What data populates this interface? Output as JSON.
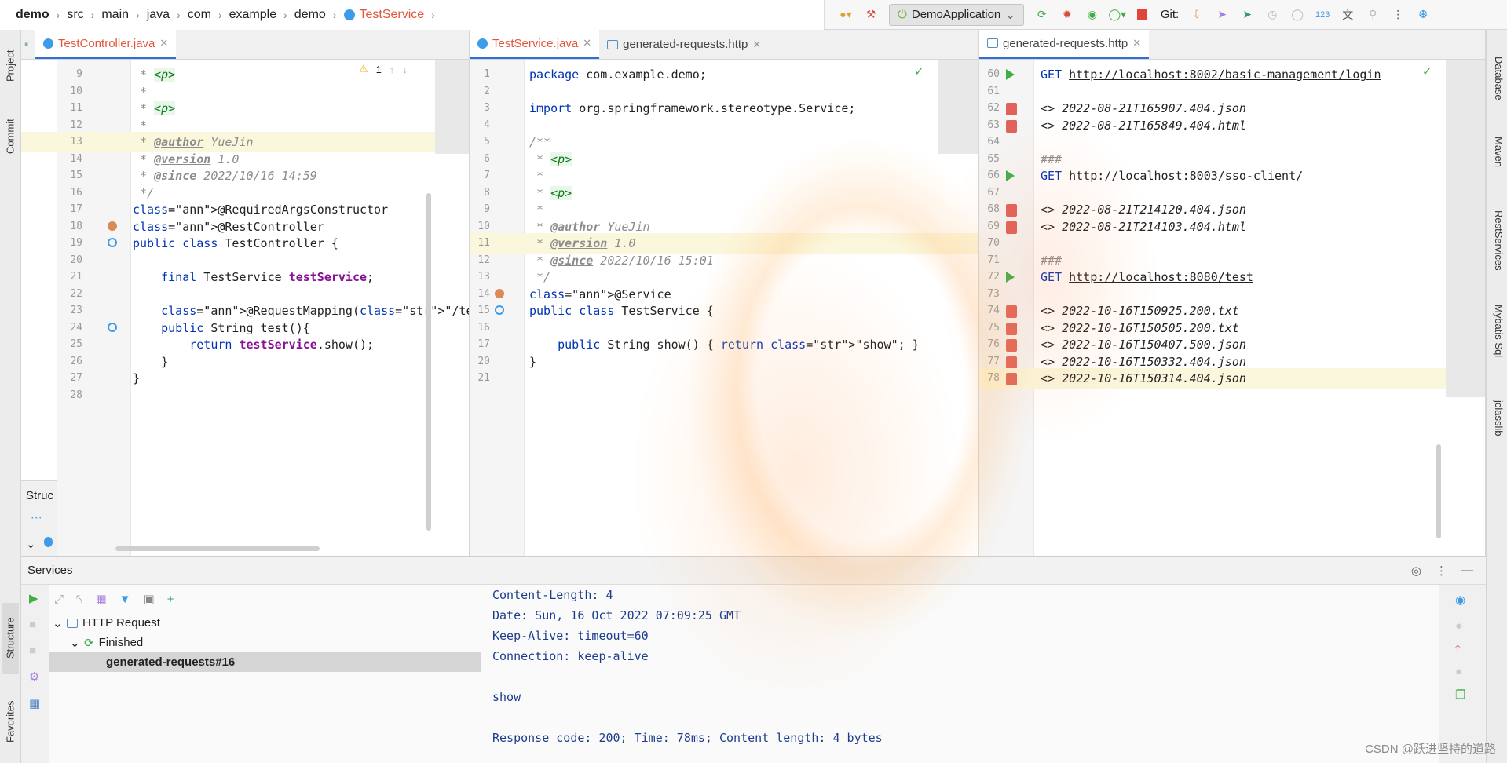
{
  "breadcrumb": [
    "demo",
    "src",
    "main",
    "java",
    "com",
    "example",
    "demo",
    "TestService"
  ],
  "run_config": "DemoApplication",
  "git_label": "Git:",
  "left_strip": {
    "project": "Project",
    "commit": "Commit",
    "structure": "Structure",
    "favorites": "Favorites"
  },
  "right_strip": [
    "Database",
    "Maven",
    "RestServices",
    "Mybatis Sql",
    "jclasslib"
  ],
  "pane1": {
    "tab": "TestController.java",
    "warning_count": "1",
    "lines": [
      {
        "n": "9",
        "t": " * <p>"
      },
      {
        "n": "10",
        "t": " *"
      },
      {
        "n": "11",
        "t": " * <p>"
      },
      {
        "n": "12",
        "t": " *"
      },
      {
        "n": "13",
        "t": " * @author YueJin"
      },
      {
        "n": "14",
        "t": " * @version 1.0"
      },
      {
        "n": "15",
        "t": " * @since 2022/10/16 14:59"
      },
      {
        "n": "16",
        "t": " */"
      },
      {
        "n": "17",
        "t": "@RequiredArgsConstructor"
      },
      {
        "n": "18",
        "t": "@RestController"
      },
      {
        "n": "19",
        "t": "public class TestController {"
      },
      {
        "n": "20",
        "t": ""
      },
      {
        "n": "21",
        "t": "    final TestService testService;"
      },
      {
        "n": "22",
        "t": ""
      },
      {
        "n": "23",
        "t": "    @RequestMapping(\"/test\")"
      },
      {
        "n": "24",
        "t": "    public String test(){"
      },
      {
        "n": "25",
        "t": "        return testService.show();"
      },
      {
        "n": "26",
        "t": "    }"
      },
      {
        "n": "27",
        "t": "}"
      },
      {
        "n": "28",
        "t": ""
      }
    ]
  },
  "pane2": {
    "tabs": [
      "TestService.java",
      "generated-requests.http"
    ],
    "lines": [
      {
        "n": "1",
        "t": "package com.example.demo;"
      },
      {
        "n": "2",
        "t": ""
      },
      {
        "n": "3",
        "t": "import org.springframework.stereotype.Service;"
      },
      {
        "n": "4",
        "t": ""
      },
      {
        "n": "5",
        "t": "/**"
      },
      {
        "n": "6",
        "t": " * <p>"
      },
      {
        "n": "7",
        "t": " *"
      },
      {
        "n": "8",
        "t": " * <p>"
      },
      {
        "n": "9",
        "t": " *"
      },
      {
        "n": "10",
        "t": " * @author YueJin"
      },
      {
        "n": "11",
        "t": " * @version 1.0"
      },
      {
        "n": "12",
        "t": " * @since 2022/10/16 15:01"
      },
      {
        "n": "13",
        "t": " */"
      },
      {
        "n": "14",
        "t": "@Service"
      },
      {
        "n": "15",
        "t": "public class TestService {"
      },
      {
        "n": "16",
        "t": ""
      },
      {
        "n": "17",
        "t": "    public String show() { return \"show\"; }"
      },
      {
        "n": "20",
        "t": "}"
      },
      {
        "n": "21",
        "t": ""
      }
    ]
  },
  "pane3": {
    "tab": "generated-requests.http",
    "lines": [
      {
        "n": "60",
        "t": "GET http://localhost:8002/basic-management/login"
      },
      {
        "n": "61",
        "t": ""
      },
      {
        "n": "62",
        "t": "<> 2022-08-21T165907.404.json"
      },
      {
        "n": "63",
        "t": "<> 2022-08-21T165849.404.html"
      },
      {
        "n": "64",
        "t": ""
      },
      {
        "n": "65",
        "t": "###"
      },
      {
        "n": "66",
        "t": "GET http://localhost:8003/sso-client/"
      },
      {
        "n": "67",
        "t": ""
      },
      {
        "n": "68",
        "t": "<> 2022-08-21T214120.404.json"
      },
      {
        "n": "69",
        "t": "<> 2022-08-21T214103.404.html"
      },
      {
        "n": "70",
        "t": ""
      },
      {
        "n": "71",
        "t": "###"
      },
      {
        "n": "72",
        "t": "GET http://localhost:8080/test"
      },
      {
        "n": "73",
        "t": ""
      },
      {
        "n": "74",
        "t": "<> 2022-10-16T150925.200.txt"
      },
      {
        "n": "75",
        "t": "<> 2022-10-16T150505.200.txt"
      },
      {
        "n": "76",
        "t": "<> 2022-10-16T150407.500.json"
      },
      {
        "n": "77",
        "t": "<> 2022-10-16T150332.404.json"
      },
      {
        "n": "78",
        "t": "<> 2022-10-16T150314.404.json"
      }
    ]
  },
  "structure_mini": "Struc",
  "services": {
    "title": "Services",
    "tree": [
      "HTTP Request",
      "Finished",
      "generated-requests#16"
    ],
    "output": [
      "Content-Length: 4",
      "Date: Sun, 16 Oct 2022 07:09:25 GMT",
      "Keep-Alive: timeout=60",
      "Connection: keep-alive",
      "",
      "show",
      "",
      "Response code: 200; Time: 78ms; Content length: 4 bytes"
    ]
  },
  "watermark": "CSDN @跃进坚持的道路"
}
